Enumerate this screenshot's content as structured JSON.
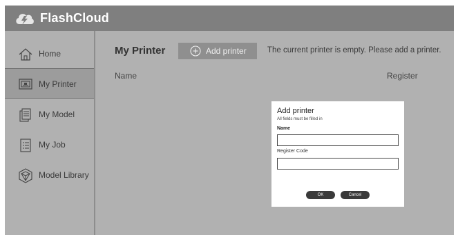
{
  "app": {
    "name": "FlashCloud"
  },
  "sidebar": {
    "items": [
      {
        "label": "Home",
        "icon": "home-icon",
        "active": false
      },
      {
        "label": "My Printer",
        "icon": "printer-icon",
        "active": true
      },
      {
        "label": "My Model",
        "icon": "model-icon",
        "active": false
      },
      {
        "label": "My Job",
        "icon": "job-list-icon",
        "active": false
      },
      {
        "label": "Model Library",
        "icon": "model-library-icon",
        "active": false
      }
    ]
  },
  "main": {
    "title": "My Printer",
    "add_button_label": "Add printer",
    "empty_message": "The current printer is empty. Please add a printer.",
    "columns": [
      "Name",
      "Register"
    ]
  },
  "dialog": {
    "title": "Add printer",
    "hint": "All fields must be filled in",
    "name_label": "Name",
    "name_value": "",
    "register_label": "Register Code",
    "register_value": "",
    "ok_label": "OK",
    "cancel_label": "Cancel"
  },
  "colors": {
    "topbar": "#7f7f7f",
    "background": "#b1b1b1",
    "active_item": "#9c9c9c",
    "button": "#8f8f8f",
    "dialog_button": "#3a3a3a"
  }
}
